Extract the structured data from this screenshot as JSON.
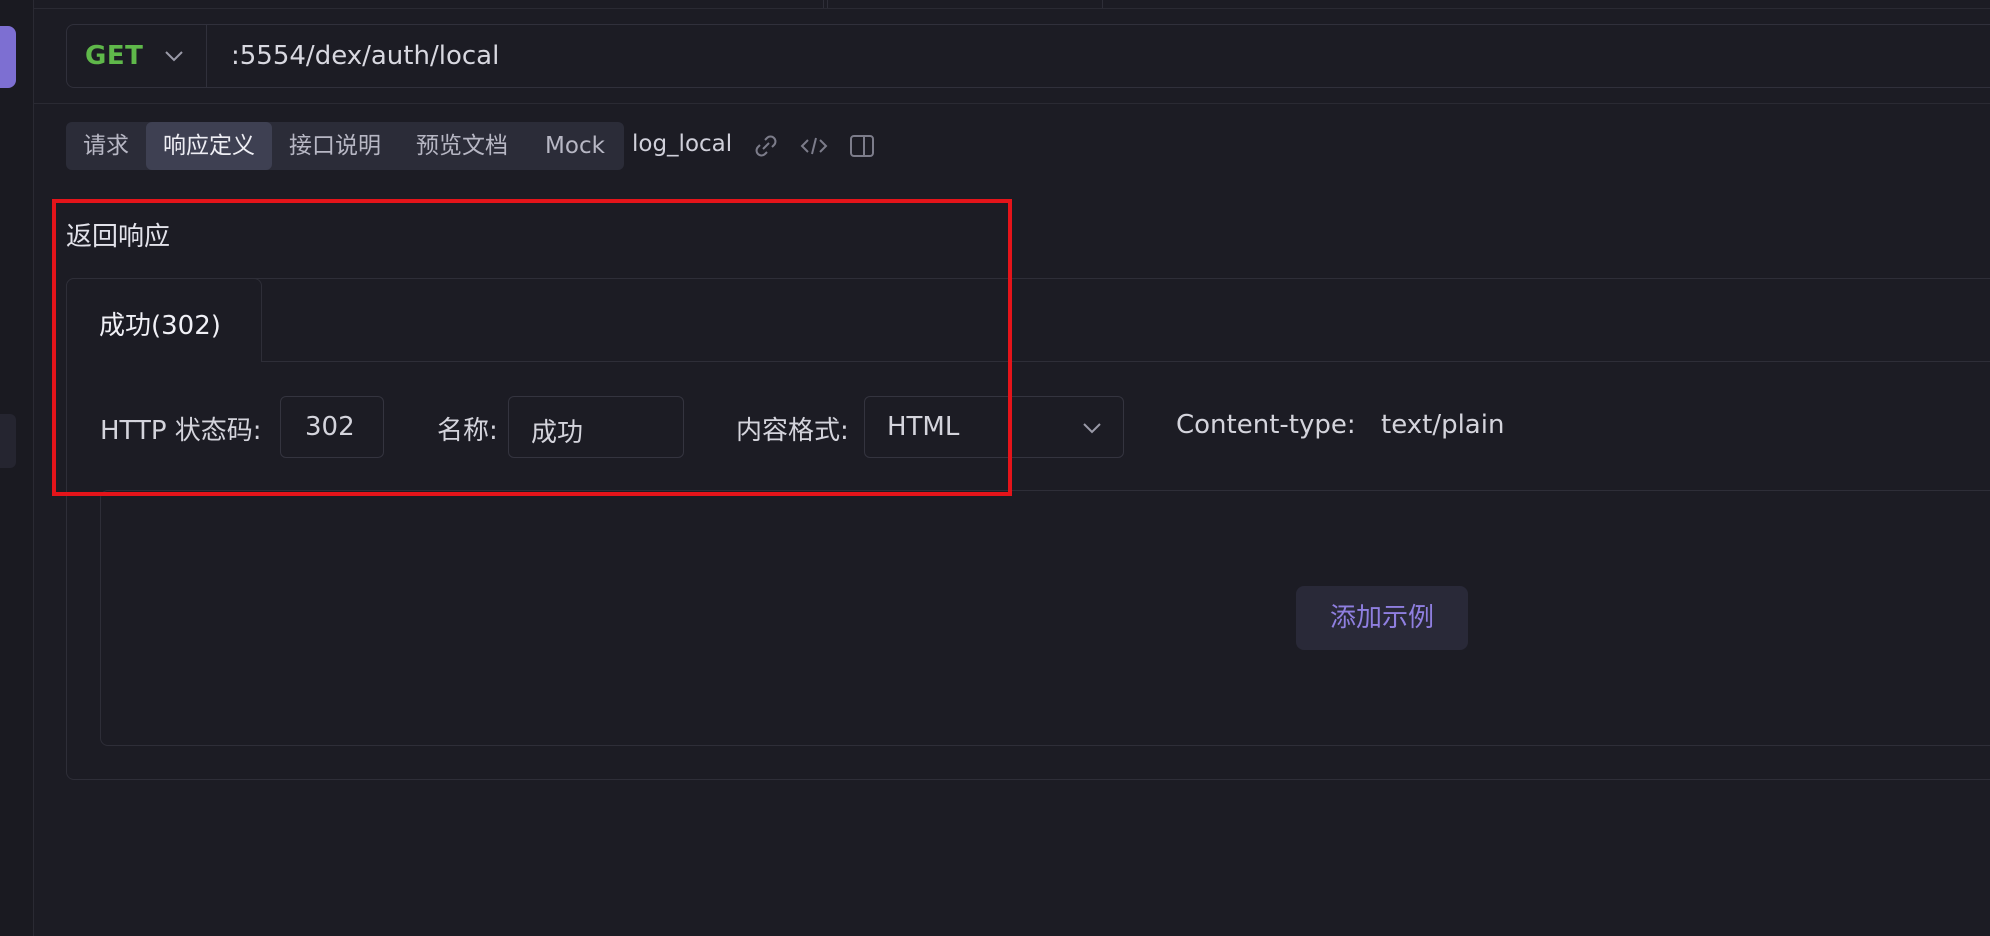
{
  "request": {
    "method": "GET",
    "url": ":5554/dex/auth/local"
  },
  "tabs": [
    {
      "label": "请求",
      "active": false
    },
    {
      "label": "响应定义",
      "active": true
    },
    {
      "label": "接口说明",
      "active": false
    },
    {
      "label": "预览文档",
      "active": false
    },
    {
      "label": "Mock",
      "active": false
    }
  ],
  "api_name": "log_local",
  "toolbar_icons": [
    "link-icon",
    "code-icon",
    "panel-icon"
  ],
  "response": {
    "section_title": "返回响应",
    "tab_label": "成功(302)",
    "status_label": "HTTP 状态码:",
    "status_value": "302",
    "name_label": "名称:",
    "name_value": "成功",
    "format_label": "内容格式:",
    "format_value": "HTML",
    "content_type_label": "Content-type:",
    "content_type_value": "text/plain",
    "add_example_label": "添加示例"
  },
  "colors": {
    "background": "#1c1c24",
    "method_get": "#5fb84a",
    "accent": "#7d6fd2",
    "add_example_text": "#8f7fe0",
    "highlight_box": "#e4141a"
  }
}
